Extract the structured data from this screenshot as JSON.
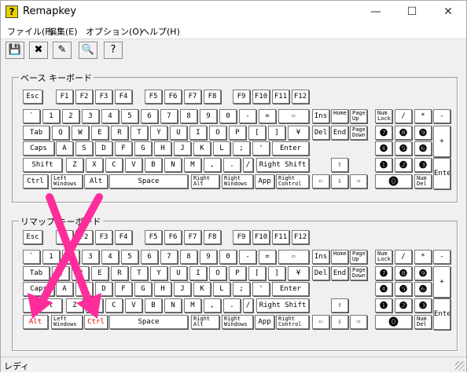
{
  "window": {
    "title": "Remapkey",
    "status": "レディ"
  },
  "menu": [
    "ファイル(F)",
    "編集(E)",
    "オプション(O)",
    "ヘルプ(H)"
  ],
  "groups": {
    "base": "ベース キーボード",
    "remap": "リマップ キーボード"
  },
  "keys": {
    "esc": "Esc",
    "f1": "F1",
    "f2": "F2",
    "f3": "F3",
    "f4": "F4",
    "f5": "F5",
    "f6": "F6",
    "f7": "F7",
    "f8": "F8",
    "f9": "F9",
    "f10": "F10",
    "f11": "F11",
    "f12": "F12",
    "grave": "`",
    "k1": "1",
    "k2": "2",
    "k3": "3",
    "k4": "4",
    "k5": "5",
    "k6": "6",
    "k7": "7",
    "k8": "8",
    "k9": "9",
    "k0": "0",
    "minus": "-",
    "equal": "=",
    "bksp": "⇦",
    "tab": "Tab",
    "q": "Q",
    "w": "W",
    "e": "E",
    "r": "R",
    "t": "T",
    "y": "Y",
    "u": "U",
    "i": "I",
    "o": "O",
    "p": "P",
    "lbr": "[",
    "rbr": "]",
    "yen": "¥",
    "caps": "Caps",
    "a": "A",
    "s": "S",
    "d": "D",
    "f": "F",
    "g": "G",
    "h": "H",
    "j": "J",
    "k": "K",
    "l": "L",
    "semi": ";",
    "quote": "'",
    "enter": "Enter",
    "shift": "Shift",
    "z": "Z",
    "x": "X",
    "c": "C",
    "v": "V",
    "b": "B",
    "n": "N",
    "m": "M",
    "comma": ",",
    "period": ".",
    "slash": "/",
    "rshift": "Right Shift",
    "ctrl": "Ctrl",
    "lwin": "Left Windows",
    "alt": "Alt",
    "space": "Space",
    "ralt": "Right Alt",
    "rwin": "Right Windows",
    "app": "App",
    "rctrl": "Right Control",
    "ins": "Ins",
    "home": "Home",
    "pgup": "Page Up",
    "del": "Del",
    "end": "End",
    "pgdn": "Page Down",
    "up": "⇧",
    "left": "⇦",
    "down": "⇩",
    "right": "⇨",
    "numlock": "Num Lock",
    "ndiv": "/",
    "nmul": "*",
    "nminus": "-",
    "n7": "❼",
    "n8": "❽",
    "n9": "❾",
    "nplus": "+",
    "n4": "❹",
    "n5": "❺",
    "n6": "❻",
    "n1": "❶",
    "n2": "❷",
    "n3": "❸",
    "nenter": "Enter",
    "n0": "⓿",
    "ndel": "Num Del"
  },
  "remapped": {
    "left_ctrl_slot": "Alt",
    "left_alt_slot": "Ctrl"
  },
  "colors": {
    "remapped_text": "#dd0000",
    "arrow": "#ff2d9b"
  }
}
